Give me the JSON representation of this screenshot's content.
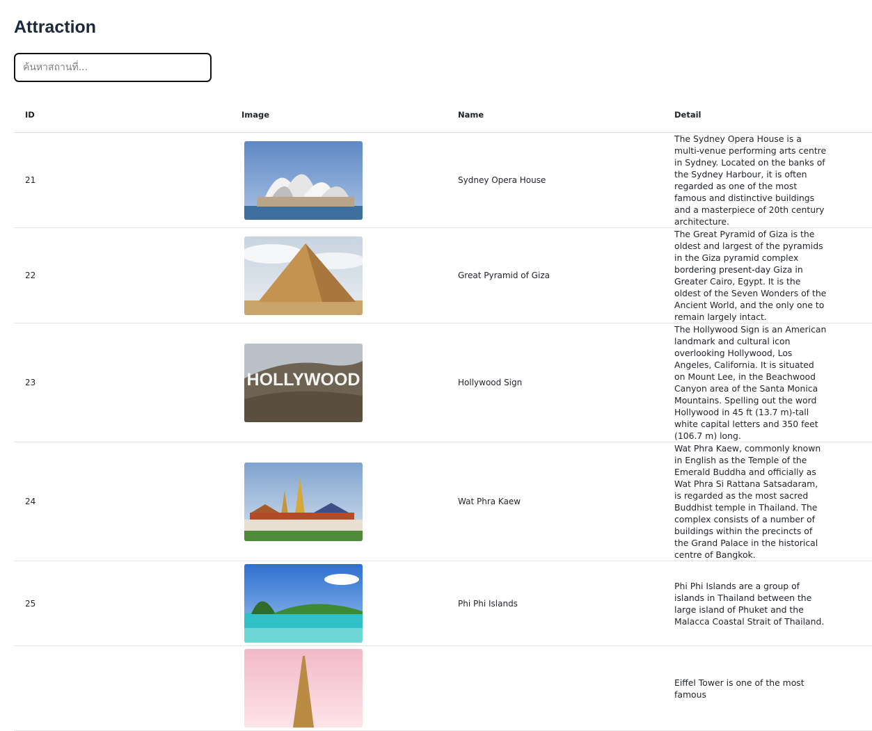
{
  "page": {
    "title": "Attraction"
  },
  "search": {
    "placeholder": "ค้นหาสถานที่..."
  },
  "table": {
    "headers": {
      "id": "ID",
      "image": "Image",
      "name": "Name",
      "detail": "Detail"
    },
    "rows": [
      {
        "id": "21",
        "image_icon": "sydney-opera-house-photo",
        "name": "Sydney Opera House",
        "detail": "The Sydney Opera House is a multi-venue performing arts centre in Sydney. Located on the banks of the Sydney Harbour, it is often regarded as one of the most famous and distinctive buildings and a masterpiece of 20th century architecture."
      },
      {
        "id": "22",
        "image_icon": "great-pyramid-photo",
        "name": "Great Pyramid of Giza",
        "detail": "The Great Pyramid of Giza is the oldest and largest of the pyramids in the Giza pyramid complex bordering present-day Giza in Greater Cairo, Egypt. It is the oldest of the Seven Wonders of the Ancient World, and the only one to remain largely intact."
      },
      {
        "id": "23",
        "image_icon": "hollywood-sign-photo",
        "name": "Hollywood Sign",
        "image_text": "HOLLYWOOD",
        "detail": "The Hollywood Sign is an American landmark and cultural icon overlooking Hollywood, Los Angeles, California. It is situated on Mount Lee, in the Beachwood Canyon area of the Santa Monica Mountains. Spelling out the word Hollywood in 45 ft (13.7 m)-tall white capital letters and 350 feet (106.7 m) long."
      },
      {
        "id": "24",
        "image_icon": "wat-phra-kaew-photo",
        "name": "Wat Phra Kaew",
        "detail": "Wat Phra Kaew, commonly known in English as the Temple of the Emerald Buddha and officially as Wat Phra Si Rattana Satsadaram, is regarded as the most sacred Buddhist temple in Thailand. The complex consists of a number of buildings within the precincts of the Grand Palace in the historical centre of Bangkok."
      },
      {
        "id": "25",
        "image_icon": "phi-phi-islands-photo",
        "name": "Phi Phi Islands",
        "detail": "Phi Phi Islands are a group of islands in Thailand between the large island of Phuket and the Malacca Coastal Strait of Thailand."
      },
      {
        "id": "",
        "image_icon": "eiffel-tower-photo",
        "name": "",
        "detail": "Eiffel Tower is one of the most famous"
      }
    ]
  }
}
